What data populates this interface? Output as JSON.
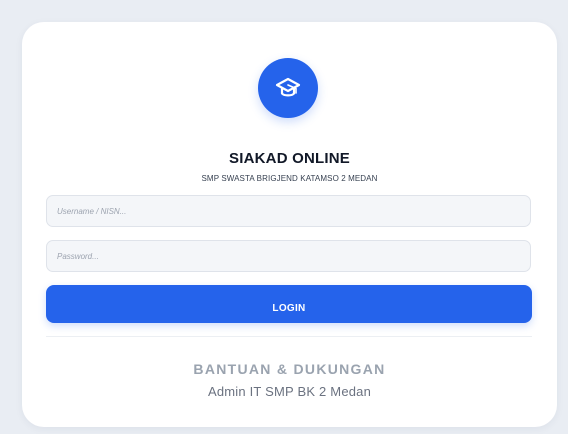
{
  "app": {
    "logo_icon": "graduation-cap-icon",
    "title": "SIAKAD ONLINE",
    "subtitle": "SMP SWASTA BRIGJEND KATAMSO 2 MEDAN"
  },
  "login_form": {
    "username": {
      "placeholder": "Username / NISN...",
      "value": ""
    },
    "password": {
      "placeholder": "Password...",
      "value": ""
    },
    "submit_label": "LOGIN"
  },
  "support": {
    "title": "BANTUAN & DUKUNGAN",
    "text": "Admin IT SMP BK 2 Medan"
  },
  "colors": {
    "background": "#e9edf3",
    "card": "#ffffff",
    "primary": "#2563eb",
    "input_background": "#f4f6f9",
    "muted_heading": "#9aa3af",
    "muted_text": "#6b7280"
  }
}
